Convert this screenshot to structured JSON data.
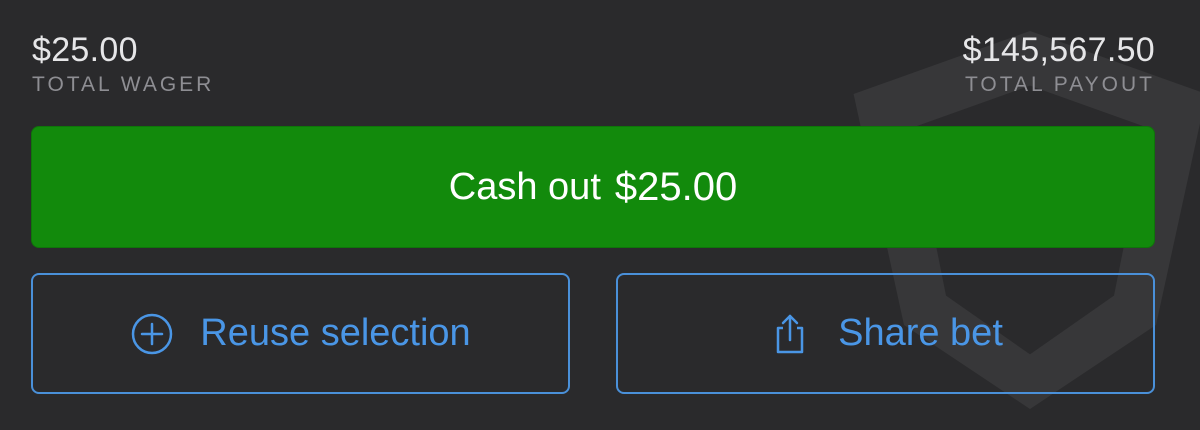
{
  "summary": {
    "wager_amount": "$25.00",
    "wager_label": "TOTAL WAGER",
    "payout_amount": "$145,567.50",
    "payout_label": "TOTAL PAYOUT"
  },
  "cashout": {
    "label": "Cash out",
    "amount": "$25.00",
    "color": "#128a0c"
  },
  "actions": {
    "reuse_label": "Reuse selection",
    "reuse_icon": "plus-circle-icon",
    "share_label": "Share bet",
    "share_icon": "share-icon",
    "accent_color": "#4a96e6"
  },
  "colors": {
    "background": "#2a2a2c",
    "muted_text": "#8e8e93"
  }
}
